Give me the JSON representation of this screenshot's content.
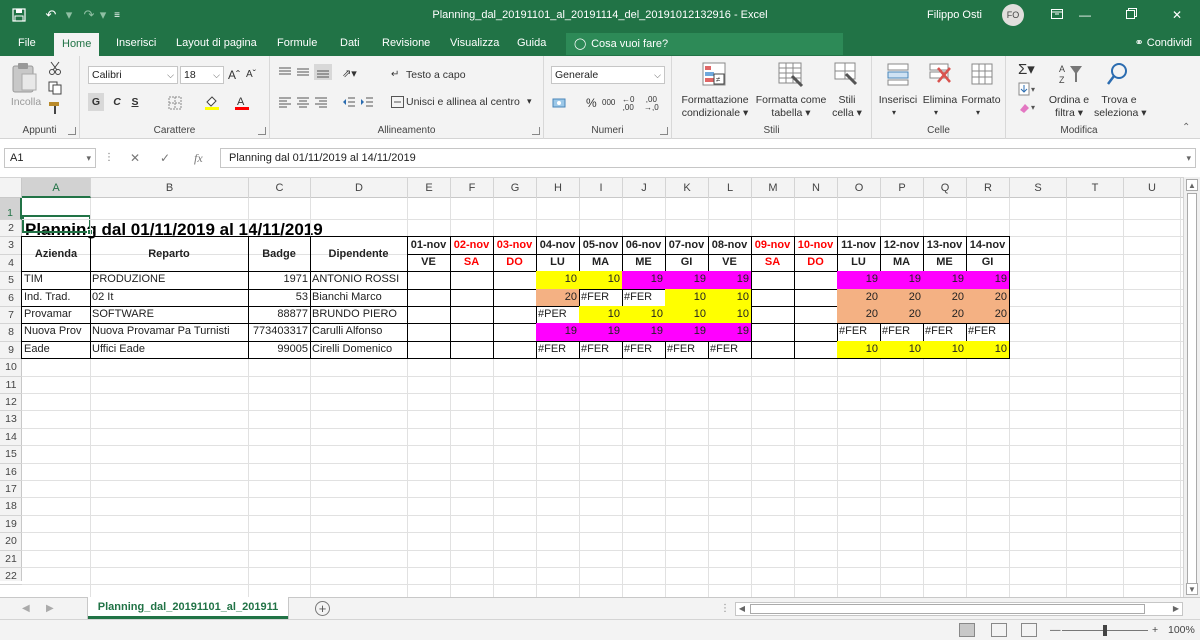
{
  "window": {
    "title": "Planning_dal_20191101_al_20191114_del_20191012132916  -  Excel",
    "user": "Filippo Osti",
    "avatar": "FO"
  },
  "quick_access": [
    "save-icon",
    "undo-icon",
    "redo-icon",
    "customize-icon"
  ],
  "tabs": [
    "File",
    "Home",
    "Inserisci",
    "Layout di pagina",
    "Formule",
    "Dati",
    "Revisione",
    "Visualizza",
    "Guida"
  ],
  "active_tab": "Home",
  "tell_me": "Cosa vuoi fare?",
  "share": "Condividi",
  "ribbon": {
    "groups": {
      "clipboard": "Appunti",
      "font": "Carattere",
      "alignment": "Allineamento",
      "number": "Numeri",
      "styles": "Stili",
      "cells": "Celle",
      "editing": "Modifica"
    },
    "paste": "Incolla",
    "font_name": "Calibri",
    "font_size": "18",
    "bold": "G",
    "italic": "C",
    "underline": "S",
    "wrap_text": "Testo a capo",
    "merge_center": "Unisci e allinea al centro",
    "number_format": "Generale",
    "percent": "%",
    "thousands": "000",
    "cond_format": [
      "Formattazione",
      "condizionale"
    ],
    "format_table": [
      "Formatta come",
      "tabella"
    ],
    "cell_styles": [
      "Stili",
      "cella"
    ],
    "insert": "Inserisci",
    "delete": "Elimina",
    "format": "Formato",
    "sort_filter": [
      "Ordina e",
      "filtra"
    ],
    "find_select": [
      "Trova e",
      "seleziona"
    ]
  },
  "formula_bar": {
    "name_box": "A1",
    "fx": "fx",
    "content": "Planning dal 01/11/2019 al 14/11/2019"
  },
  "columns": [
    "A",
    "B",
    "C",
    "D",
    "E",
    "F",
    "G",
    "H",
    "I",
    "J",
    "K",
    "L",
    "M",
    "N",
    "O",
    "P",
    "Q",
    "R",
    "S",
    "T",
    "U"
  ],
  "rows": [
    "1",
    "2",
    "3",
    "4",
    "5",
    "6",
    "7",
    "8",
    "9",
    "10",
    "11",
    "12",
    "13",
    "14",
    "15",
    "16",
    "17",
    "18",
    "19",
    "20",
    "21",
    "22"
  ],
  "sheet": {
    "title": "Planning dal 01/11/2019 al 14/11/2019",
    "headers": [
      "Azienda",
      "Reparto",
      "Badge",
      "Dipendente"
    ],
    "dates": [
      "01-nov",
      "02-nov",
      "03-nov",
      "04-nov",
      "05-nov",
      "06-nov",
      "07-nov",
      "08-nov",
      "09-nov",
      "10-nov",
      "11-nov",
      "12-nov",
      "13-nov",
      "14-nov"
    ],
    "days": [
      "VE",
      "SA",
      "DO",
      "LU",
      "MA",
      "ME",
      "GI",
      "VE",
      "SA",
      "DO",
      "LU",
      "MA",
      "ME",
      "GI"
    ],
    "weekend": [
      false,
      true,
      true,
      false,
      false,
      false,
      false,
      false,
      true,
      true,
      false,
      false,
      false,
      false
    ],
    "colors": {
      "yellow": "#ffff00",
      "magenta": "#ff00ff",
      "orange": "#f4b183",
      "red_text": "#ff0000"
    },
    "employees": [
      {
        "azienda": "TIM",
        "reparto": "PRODUZIONE",
        "badge": "1971",
        "dipendente": "ANTONIO ROSSI",
        "cells": [
          {
            "v": ""
          },
          {
            "v": ""
          },
          {
            "v": ""
          },
          {
            "v": "10",
            "c": "yellow"
          },
          {
            "v": "10",
            "c": "yellow"
          },
          {
            "v": "19",
            "c": "magenta"
          },
          {
            "v": "19",
            "c": "magenta"
          },
          {
            "v": "19",
            "c": "magenta"
          },
          {
            "v": ""
          },
          {
            "v": ""
          },
          {
            "v": "19",
            "c": "magenta"
          },
          {
            "v": "19",
            "c": "magenta"
          },
          {
            "v": "19",
            "c": "magenta"
          },
          {
            "v": "19",
            "c": "magenta"
          }
        ]
      },
      {
        "azienda": "Ind. Trad.",
        "reparto": "02 It",
        "badge": "53",
        "dipendente": "Bianchi Marco",
        "cells": [
          {
            "v": ""
          },
          {
            "v": ""
          },
          {
            "v": ""
          },
          {
            "v": "20",
            "c": "orange"
          },
          {
            "v": "#FER"
          },
          {
            "v": "#FER"
          },
          {
            "v": "10",
            "c": "yellow"
          },
          {
            "v": "10",
            "c": "yellow"
          },
          {
            "v": ""
          },
          {
            "v": ""
          },
          {
            "v": "20",
            "c": "orange"
          },
          {
            "v": "20",
            "c": "orange"
          },
          {
            "v": "20",
            "c": "orange"
          },
          {
            "v": "20",
            "c": "orange"
          }
        ]
      },
      {
        "azienda": "Provamar",
        "reparto": "SOFTWARE",
        "badge": "88877",
        "dipendente": "BRUNDO PIERO",
        "cells": [
          {
            "v": ""
          },
          {
            "v": ""
          },
          {
            "v": ""
          },
          {
            "v": "#PER"
          },
          {
            "v": "10",
            "c": "yellow"
          },
          {
            "v": "10",
            "c": "yellow"
          },
          {
            "v": "10",
            "c": "yellow"
          },
          {
            "v": "10",
            "c": "yellow"
          },
          {
            "v": ""
          },
          {
            "v": ""
          },
          {
            "v": "20",
            "c": "orange"
          },
          {
            "v": "20",
            "c": "orange"
          },
          {
            "v": "20",
            "c": "orange"
          },
          {
            "v": "20",
            "c": "orange"
          }
        ]
      },
      {
        "azienda": "Nuova Prov",
        "reparto": "Nuova Provamar Pa Turnisti",
        "badge": "773403317",
        "dipendente": "Carulli Alfonso",
        "cells": [
          {
            "v": ""
          },
          {
            "v": ""
          },
          {
            "v": ""
          },
          {
            "v": "19",
            "c": "magenta"
          },
          {
            "v": "19",
            "c": "magenta"
          },
          {
            "v": "19",
            "c": "magenta"
          },
          {
            "v": "19",
            "c": "magenta"
          },
          {
            "v": "19",
            "c": "magenta"
          },
          {
            "v": ""
          },
          {
            "v": ""
          },
          {
            "v": "#FER"
          },
          {
            "v": "#FER"
          },
          {
            "v": "#FER"
          },
          {
            "v": "#FER"
          }
        ]
      },
      {
        "azienda": "Eade",
        "reparto": "Uffici Eade",
        "badge": "99005",
        "dipendente": "Cirelli Domenico",
        "cells": [
          {
            "v": ""
          },
          {
            "v": ""
          },
          {
            "v": ""
          },
          {
            "v": "#FER"
          },
          {
            "v": "#FER"
          },
          {
            "v": "#FER"
          },
          {
            "v": "#FER"
          },
          {
            "v": "#FER"
          },
          {
            "v": ""
          },
          {
            "v": ""
          },
          {
            "v": "10",
            "c": "yellow"
          },
          {
            "v": "10",
            "c": "yellow"
          },
          {
            "v": "10",
            "c": "yellow"
          },
          {
            "v": "10",
            "c": "yellow"
          }
        ]
      }
    ]
  },
  "sheet_tab": "Planning_dal_20191101_al_201911",
  "status": {
    "zoom": "100%"
  }
}
